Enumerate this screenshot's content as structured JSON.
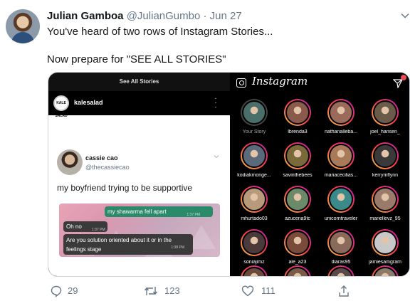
{
  "tweet": {
    "name": "Julian Gamboa",
    "handle": "@JulianGumbo",
    "separator": " · ",
    "date": "Jun 27",
    "line1": "You've heard of two rows of Instagram Stories...",
    "line2": "Now prepare for \"SEE ALL STORIES\""
  },
  "left_panel": {
    "title": "See All Stories",
    "user_badge": "KALE SALAD",
    "username": "kalesalad",
    "quoted": {
      "name": "cassie cao",
      "handle": "@thecassiecao",
      "text": "my boyfriend trying to be supportive"
    },
    "chat": {
      "msg1": "my shawarma fell apart",
      "time1": "1:37 PM",
      "msg2": "Oh no",
      "time2": "1:37 PM",
      "msg3": "Are you solution oriented about it or in the feelings stage",
      "time3": "1:38 PM"
    }
  },
  "right_panel": {
    "logo": "Instagram",
    "stories": [
      {
        "name": "Your Story",
        "color": "#4a6f6a"
      },
      {
        "name": "lbrenda3",
        "color": "#8a5a4a"
      },
      {
        "name": "nathanalleba...",
        "color": "#9a6b5b"
      },
      {
        "name": "joel_hansen_",
        "color": "#6a5a4a"
      },
      {
        "name": "kodiakmonge...",
        "color": "#5a6a7a"
      },
      {
        "name": "savinthebees",
        "color": "#7a6a3a"
      },
      {
        "name": "mariacecilias...",
        "color": "#a87a5a"
      },
      {
        "name": "kerrymflynn",
        "color": "#3a3a3a"
      },
      {
        "name": "mhurtado03",
        "color": "#b89a7a"
      },
      {
        "name": "azucena9tc",
        "color": "#6a8a6a"
      },
      {
        "name": "unicorntraveler",
        "color": "#3a8a8a"
      },
      {
        "name": "mariellevz_95",
        "color": "#9a7a6a"
      },
      {
        "name": "soniajimz",
        "color": "#4a3a3a"
      },
      {
        "name": "ale_a23",
        "color": "#7a4a3a"
      },
      {
        "name": "diaras95",
        "color": "#8a6a5a"
      },
      {
        "name": "jamiesamgram",
        "color": "#c8c8c8"
      },
      {
        "name": "",
        "color": "#6a4a3a"
      },
      {
        "name": "",
        "color": "#7a5a4a"
      },
      {
        "name": "",
        "color": "#5a4a4a"
      },
      {
        "name": "",
        "color": "#8a7a6a"
      }
    ]
  },
  "actions": {
    "replies": "29",
    "retweets": "123",
    "likes": "111"
  }
}
